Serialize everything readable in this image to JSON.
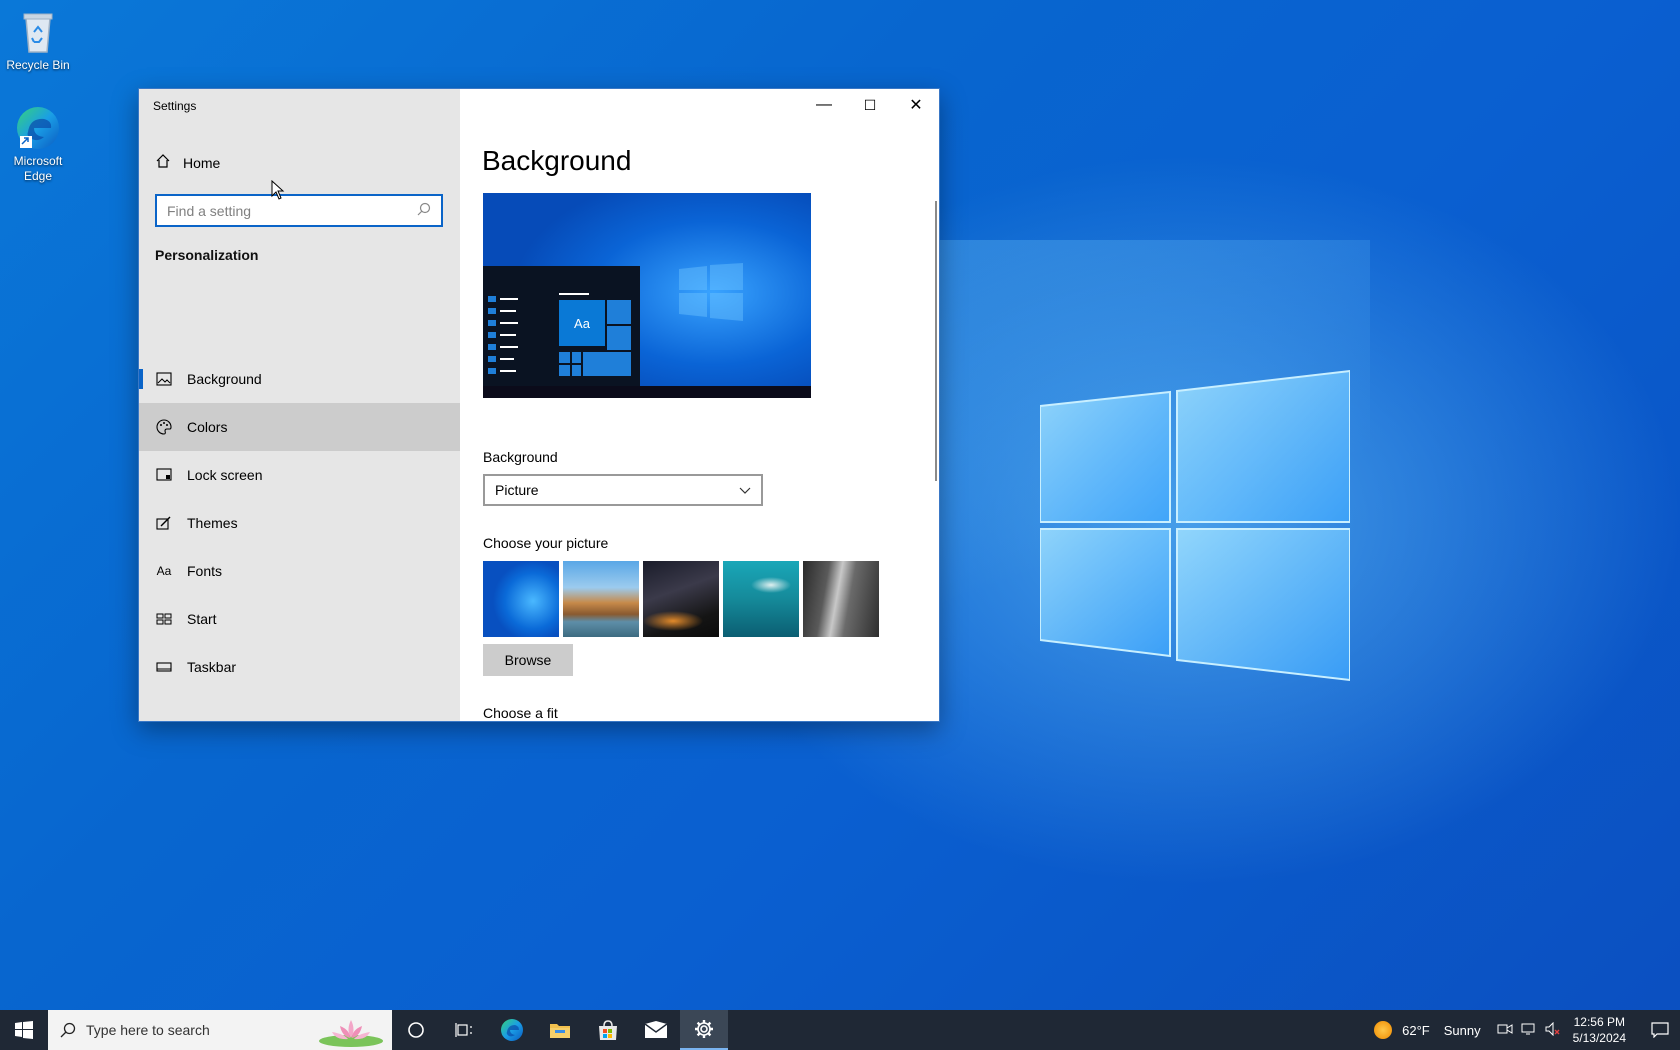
{
  "desktop": {
    "icons": [
      {
        "label": "Recycle Bin",
        "icon": "recycle-bin-icon"
      },
      {
        "label": "Microsoft Edge",
        "icon": "edge-icon"
      }
    ]
  },
  "window": {
    "title": "Settings",
    "controls": {
      "minimize": "—",
      "maximize": "☐",
      "close": "✕"
    }
  },
  "sidebar": {
    "home_label": "Home",
    "search_placeholder": "Find a setting",
    "section_title": "Personalization",
    "items": [
      {
        "label": "Background",
        "icon": "picture-icon",
        "state": "selected"
      },
      {
        "label": "Colors",
        "icon": "palette-icon",
        "state": "hover"
      },
      {
        "label": "Lock screen",
        "icon": "lock-screen-icon",
        "state": ""
      },
      {
        "label": "Themes",
        "icon": "brush-icon",
        "state": ""
      },
      {
        "label": "Fonts",
        "icon": "font-icon",
        "state": ""
      },
      {
        "label": "Start",
        "icon": "start-icon",
        "state": ""
      },
      {
        "label": "Taskbar",
        "icon": "taskbar-icon",
        "state": ""
      }
    ]
  },
  "main": {
    "title": "Background",
    "preview": {
      "tile_label": "Aa"
    },
    "background_label": "Background",
    "background_value": "Picture",
    "choose_picture_label": "Choose your picture",
    "pictures": [
      "windows-blue",
      "beach-rocks",
      "milky-way-night",
      "underwater-swimmer",
      "rock-cliff"
    ],
    "browse_label": "Browse",
    "choose_fit_label": "Choose a fit"
  },
  "taskbar": {
    "search_placeholder": "Type here to search",
    "pinned": [
      "cortana-icon",
      "task-view-icon",
      "edge-icon",
      "file-explorer-icon",
      "store-icon",
      "mail-icon",
      "settings-icon"
    ],
    "active": "settings-icon",
    "weather": {
      "temp": "62°F",
      "condition": "Sunny"
    },
    "time": "12:56 PM",
    "date": "5/13/2024"
  },
  "colors": {
    "accent": "#0a64c8",
    "desktop": "#0a6fd6",
    "taskbar": "#1f2835"
  }
}
